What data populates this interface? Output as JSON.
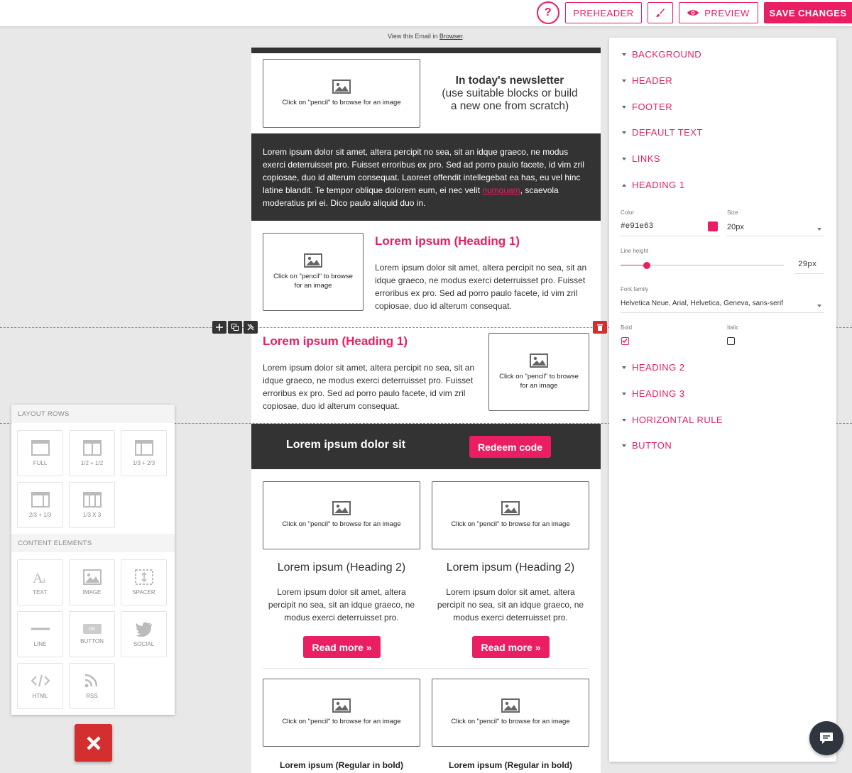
{
  "toolbar": {
    "help_label": "?",
    "preheader_label": "PREHEADER",
    "preview_label": "PREVIEW",
    "save_label": "SAVE CHANGES"
  },
  "email": {
    "view_prefix": "View this Email in",
    "view_link": "Browser",
    "view_suffix": ".",
    "image_placeholder_wide": "Click on \"pencil\" to browse for an image",
    "image_placeholder_narrow": "Click on \"pencil\" to browse for an image",
    "intro": {
      "title": "In today's newsletter",
      "subtitle": "(use suitable blocks or build a new one from scratch)"
    },
    "dark_text_before": "Lorem ipsum dolor sit amet, altera percipit no sea, sit an idque graeco, ne modus exerci deterruisset pro. Fuisset erroribus ex pro. Sed ad porro paulo facete, id vim zril copiosae, duo id alterum consequat. Laoreet offendit intellegebat ea has, eu vel hinc latine blandit. Te tempor oblique dolorem eum, ei nec velit ",
    "dark_text_link": "numquam",
    "dark_text_after": ", scaevola moderatius pri ei. Dico paulo aliquid duo in.",
    "heading1": "Lorem ipsum (Heading 1)",
    "para1": "Lorem ipsum dolor sit amet, altera percipit no sea, sit an idque graeco, ne modus exerci deterruisset pro. Fuisset erroribus ex pro. Sed ad porro paulo facete, id vim zril copiosae, duo id alterum consequat.",
    "cta_title": "Lorem ipsum dolor sit",
    "cta_button": "Redeem code",
    "heading2": "Lorem ipsum (Heading 2)",
    "para2": "Lorem ipsum dolor sit amet, altera percipit no sea, sit an idque graeco, ne modus exerci deterruisset pro.",
    "read_more": "Read more »",
    "regular_bold": "Lorem ipsum (Regular in bold)"
  },
  "settings": {
    "sections_top": [
      "BACKGROUND",
      "HEADER",
      "FOOTER",
      "DEFAULT TEXT",
      "LINKS"
    ],
    "open_section": "HEADING 1",
    "color_label": "Color",
    "color_value": "#e91e63",
    "size_label": "Size",
    "size_value": "20px",
    "line_height_label": "Line height",
    "line_height_value": "29px",
    "font_family_label": "Font family",
    "font_family_value": "Helvetica Neue, Arial, Helvetica, Geneva, sans-serif",
    "bold_label": "Bold",
    "bold_checked": true,
    "italic_label": "Italic",
    "italic_checked": false,
    "sections_bottom": [
      "HEADING 2",
      "HEADING 3",
      "HORIZONTAL RULE",
      "BUTTON"
    ]
  },
  "blocks": {
    "layout_header": "LAYOUT ROWS",
    "layout_rows": [
      "FULL",
      "1/2 + 1/2",
      "1/3 + 2/3",
      "2/3 + 1/3",
      "1/3 X 3"
    ],
    "content_header": "CONTENT ELEMENTS",
    "content_elements": [
      "TEXT",
      "IMAGE",
      "SPACER",
      "LINE",
      "BUTTON",
      "SOCIAL",
      "HTML",
      "RSS"
    ],
    "button_tile_ok": "OK"
  },
  "colors": {
    "accent": "#e91e63",
    "dark": "#333333",
    "danger": "#d32f2f"
  }
}
